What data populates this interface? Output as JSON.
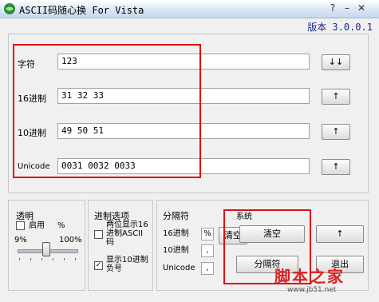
{
  "window": {
    "title": "ASCII码随心换 For Vista",
    "version": "版本 3.0.0.1",
    "icons": [
      "app-logo-icon",
      "help-icon",
      "minimize-icon",
      "close-icon"
    ]
  },
  "rows": [
    {
      "label": "字符",
      "value": "123",
      "button": "↓↓"
    },
    {
      "label": "16进制",
      "value": "31 32 33",
      "button": "↑"
    },
    {
      "label": "10进制",
      "value": "49 50 51",
      "button": "↑"
    },
    {
      "label": "Unicode",
      "value": "0031 0032 0033",
      "button": "↑"
    }
  ],
  "transparency": {
    "title": "透明",
    "enable_label": "启用",
    "enabled": false,
    "percent_sign": "%",
    "min_label": "9%",
    "max_label": "100%",
    "level_fraction": 0.45
  },
  "conversion_options": {
    "title": "进制选项",
    "option1": "两位显示16进制ASCII码",
    "option1_checked": false,
    "option2": "显示10进制负号",
    "option2_checked": true
  },
  "separator": {
    "title": "分隔符",
    "hex_label": "16进制",
    "hex_value": "%",
    "dec_label": "10进制",
    "dec_value": ",",
    "unicode_label": "Unicode",
    "unicode_value": ","
  },
  "action_buttons": {
    "clear": "清空",
    "clear_partial": "清空",
    "separator_btn": "分隔符",
    "exit": "退出",
    "clipped_text": "系统",
    "arrow_label": "↑"
  },
  "overlay": {
    "watermark": "脚本之家",
    "watermark_url": "www.jb51.net"
  },
  "colors": {
    "title_bar": "#d9e7f5",
    "version_text": "#1a2c8c",
    "highlight_border": "#d11111",
    "watermark": "#e02020"
  }
}
